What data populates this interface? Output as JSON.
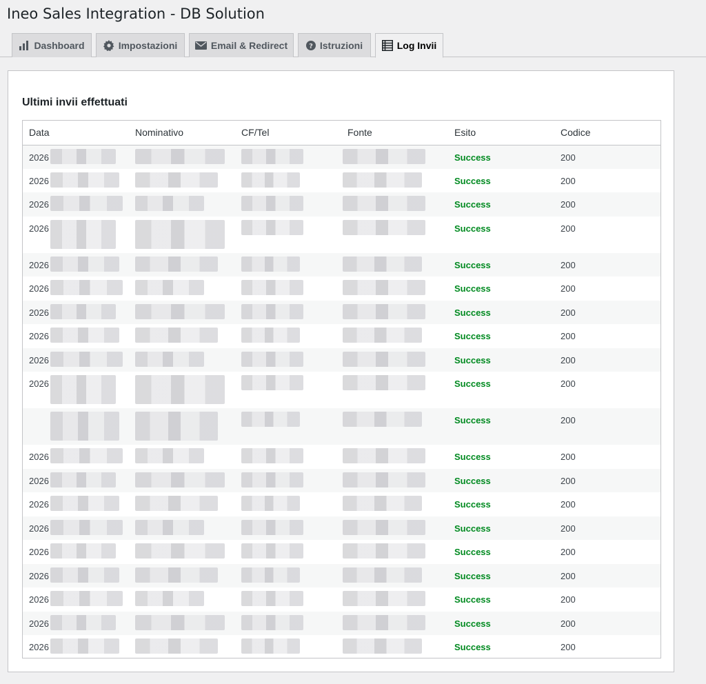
{
  "page": {
    "title": "Ineo Sales Integration - DB Solution"
  },
  "tabs": [
    {
      "label": "Dashboard",
      "icon": "bar-chart-icon",
      "active": false
    },
    {
      "label": "Impostazioni",
      "icon": "gear-icon",
      "active": false
    },
    {
      "label": "Email & Redirect",
      "icon": "envelope-icon",
      "active": false
    },
    {
      "label": "Istruzioni",
      "icon": "question-circle-icon",
      "active": false
    },
    {
      "label": "Log Invii",
      "icon": "list-icon",
      "active": true
    }
  ],
  "panel": {
    "title": "Ultimi invii effettuati"
  },
  "table": {
    "headers": [
      "Data",
      "Nominativo",
      "CF/Tel",
      "Fonte",
      "Esito",
      "Codice"
    ],
    "rows": [
      {
        "data": "2026",
        "esito": "Success",
        "codice": "200"
      },
      {
        "data": "2026",
        "esito": "Success",
        "codice": "200"
      },
      {
        "data": "2026",
        "esito": "Success",
        "codice": "200"
      },
      {
        "data": "2026",
        "esito": "Success",
        "codice": "200",
        "tall": true
      },
      {
        "data": "2026",
        "esito": "Success",
        "codice": "200"
      },
      {
        "data": "2026",
        "esito": "Success",
        "codice": "200"
      },
      {
        "data": "2026",
        "esito": "Success",
        "codice": "200"
      },
      {
        "data": "2026",
        "esito": "Success",
        "codice": "200"
      },
      {
        "data": "2026",
        "esito": "Success",
        "codice": "200"
      },
      {
        "data": "2026",
        "esito": "Success",
        "codice": "200",
        "tall": true
      },
      {
        "data": "",
        "esito": "Success",
        "codice": "200",
        "tall": true
      },
      {
        "data": "2026",
        "esito": "Success",
        "codice": "200"
      },
      {
        "data": "2026",
        "esito": "Success",
        "codice": "200"
      },
      {
        "data": "2026",
        "esito": "Success",
        "codice": "200"
      },
      {
        "data": "2026",
        "esito": "Success",
        "codice": "200"
      },
      {
        "data": "2026",
        "esito": "Success",
        "codice": "200"
      },
      {
        "data": "2026",
        "esito": "Success",
        "codice": "200"
      },
      {
        "data": "2026",
        "esito": "Success",
        "codice": "200"
      },
      {
        "data": "2026",
        "esito": "Success",
        "codice": "200"
      },
      {
        "data": "2026",
        "esito": "Success",
        "codice": "200"
      }
    ]
  },
  "colors": {
    "success": "#008a20",
    "tab_bg": "#dcdcde",
    "background": "#f0f0f1"
  }
}
